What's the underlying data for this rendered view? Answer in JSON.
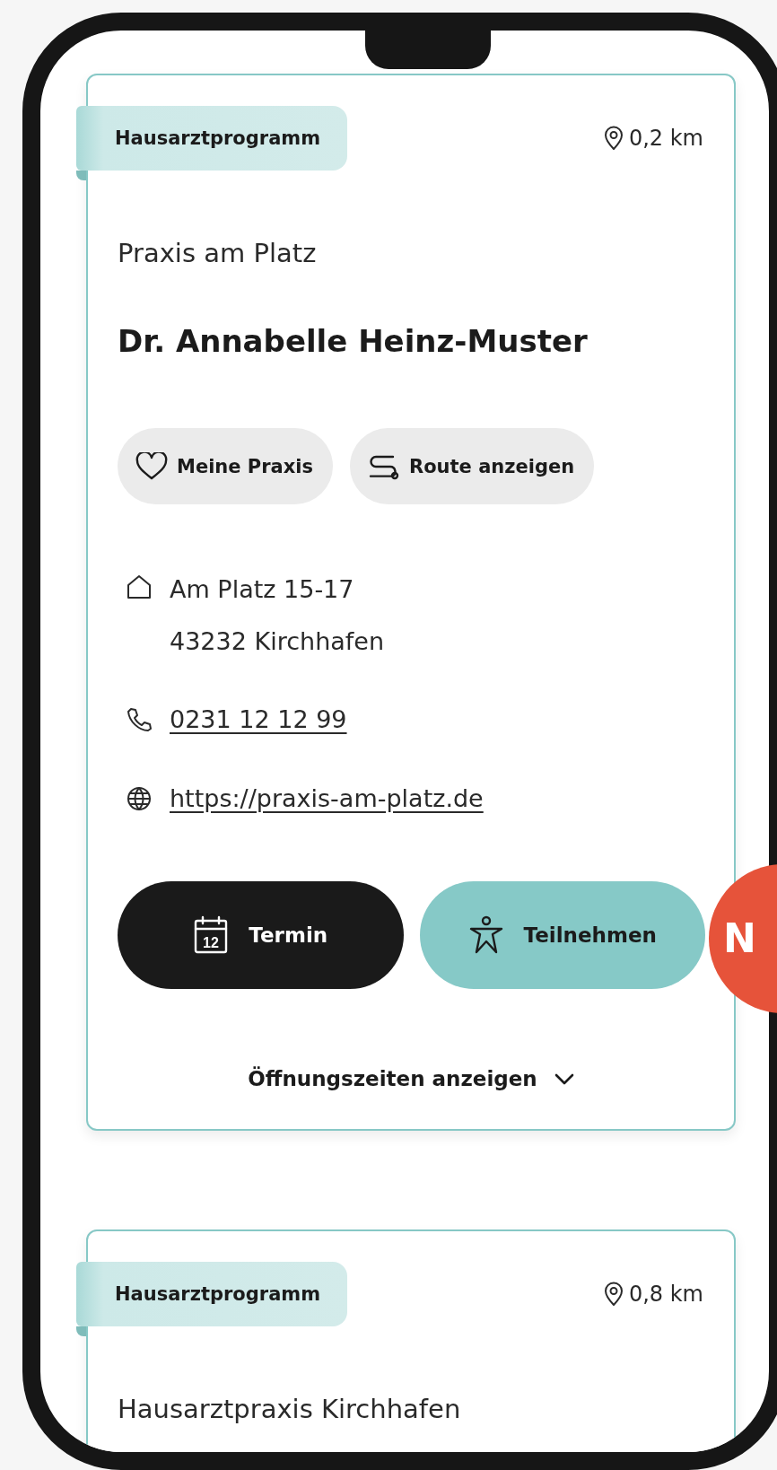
{
  "cards": [
    {
      "tag": "Hausarztprogramm",
      "distance": "0,2 km",
      "practice": "Praxis am Platz",
      "doctor": "Dr. Annabelle Heinz-Muster",
      "chips": [
        {
          "kind": "favorite",
          "label": "Meine Praxis"
        },
        {
          "kind": "route",
          "label": "Route anzeigen"
        }
      ],
      "address": [
        "Am Platz 15-17",
        "43232 Kirchhafen"
      ],
      "phone": "0231 12 12 99",
      "website": "https://praxis-am-platz.de",
      "actions": [
        {
          "kind": "appointment",
          "label": "Termin",
          "calendar_day": "12"
        },
        {
          "kind": "join",
          "label": "Teilnehmen"
        }
      ],
      "hours_toggle": {
        "label": "Öffnungszeiten anzeigen",
        "expanded": false
      }
    },
    {
      "tag": "Hausarztprogramm",
      "distance": "0,8 km",
      "practice": "Hausarztpraxis Kirchhafen"
    }
  ],
  "badge": {
    "text": "N"
  }
}
